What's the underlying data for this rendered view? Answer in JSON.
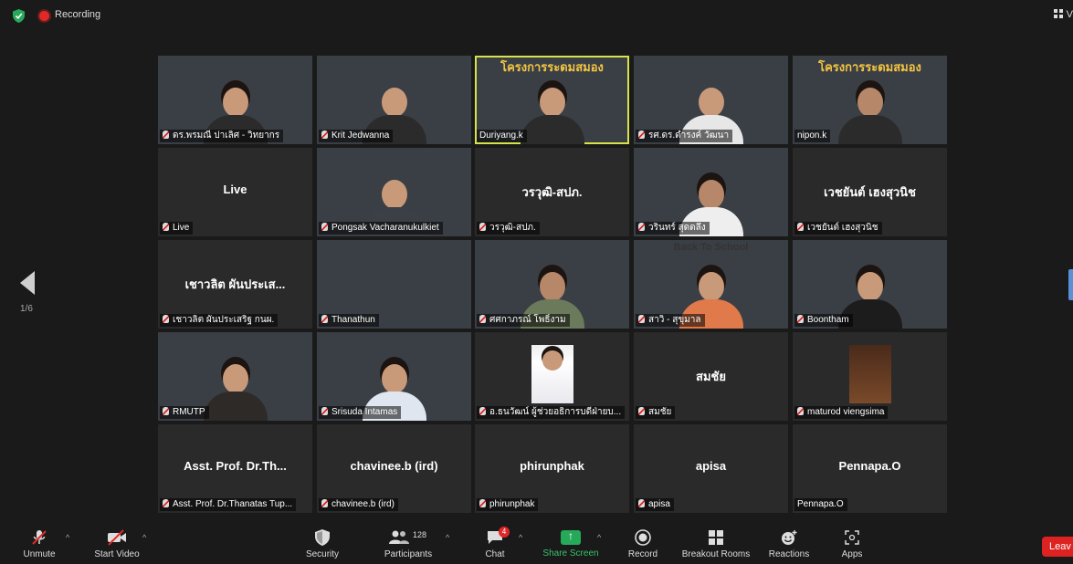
{
  "topbar": {
    "recording_label": "Recording",
    "view_label": "V"
  },
  "nav": {
    "page_indicator": "1/6"
  },
  "tiles": [
    {
      "label": "ดร.พรมณี ปาเลิศ - วิทยากร"
    },
    {
      "label": "Krit Jedwanna"
    },
    {
      "label": "Duriyang.k",
      "banner": "โครงการระดมสมอง"
    },
    {
      "label": "รศ.ดร.ดำรงค์ วัฒนา"
    },
    {
      "label": "nipon.k",
      "banner": "โครงการระดมสมอง"
    },
    {
      "label": "Live",
      "center": "Live"
    },
    {
      "label": "Pongsak Vacharanukulkiet"
    },
    {
      "label": "วรวุฒิ-สปภ.",
      "center": "วรวุฒิ-สปภ."
    },
    {
      "label": "วรินทร์ สุดดลึง"
    },
    {
      "label": "เวชยันต์ เฮงสุวนิช",
      "center": "เวชยันต์ เฮงสุวนิช"
    },
    {
      "label": "เชาวลิต ผันประเสริฐ กนผ.",
      "center": "เชาวลิต ผันประเส..."
    },
    {
      "label": "Thanathun"
    },
    {
      "label": "ศศกาภรณ์ โพธิ์งาม"
    },
    {
      "label": "สาวิ - สุขุมาล",
      "banner": "Back To School"
    },
    {
      "label": "Boontham"
    },
    {
      "label": "RMUTP"
    },
    {
      "label": "Srisuda Intamas"
    },
    {
      "label": "อ.ธนวัฒน์ ผู้ช่วยอธิการบดีฝ่ายบ..."
    },
    {
      "label": "สมชัย",
      "center": "สมชัย"
    },
    {
      "label": "maturod viengsima"
    },
    {
      "label": "Asst. Prof. Dr.Thanatas Tup...",
      "center": "Asst. Prof. Dr.Th..."
    },
    {
      "label": "chavinee.b (ird)",
      "center": "chavinee.b (ird)"
    },
    {
      "label": "phirunphak",
      "center": "phirunphak"
    },
    {
      "label": "apisa",
      "center": "apisa"
    },
    {
      "label": "Pennapa.O",
      "center": "Pennapa.O"
    }
  ],
  "toolbar": {
    "unmute": "Unmute",
    "start_video": "Start Video",
    "security": "Security",
    "participants": "Participants",
    "participants_count": "128",
    "chat": "Chat",
    "chat_badge": "4",
    "share_screen": "Share Screen",
    "record": "Record",
    "breakout_rooms": "Breakout Rooms",
    "reactions": "Reactions",
    "apps": "Apps",
    "leave": "Leav"
  },
  "colors": {
    "accent_green": "#27a95a",
    "danger_red": "#e02828",
    "active_speaker": "#d8e24a"
  }
}
